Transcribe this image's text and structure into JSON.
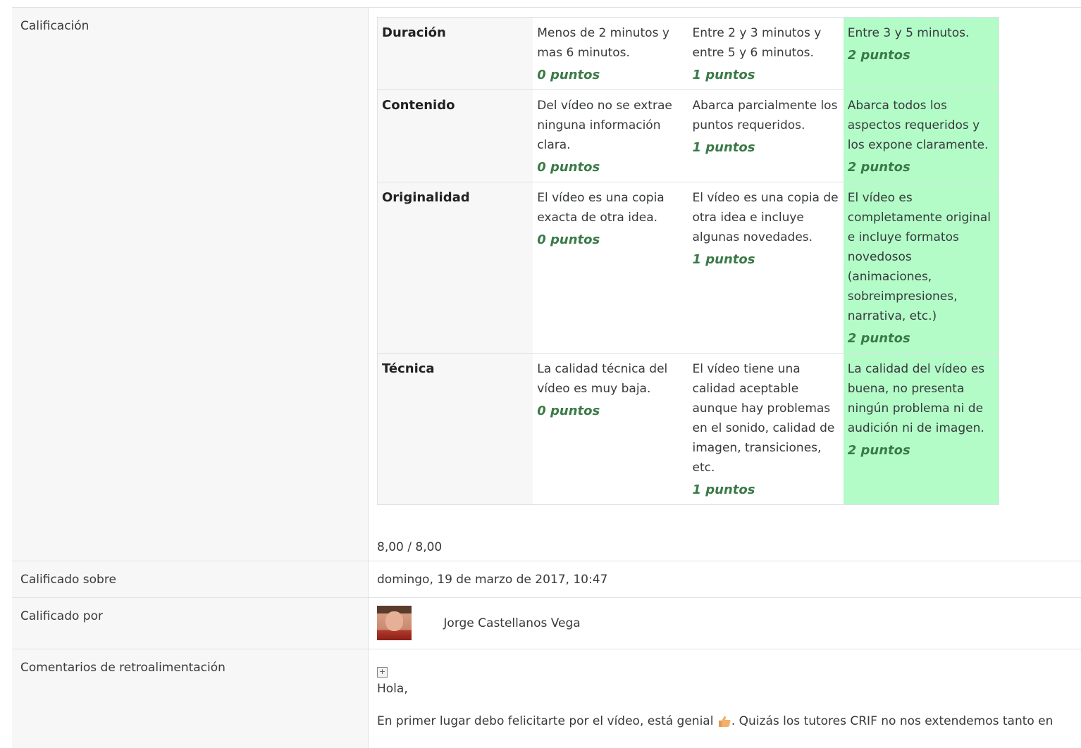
{
  "grade_label": "Calificación",
  "rubric": [
    {
      "criterion": "Duración",
      "levels": [
        {
          "definition": "Menos de 2 minutos y mas 6 minutos.",
          "points": "0 puntos",
          "selected": false
        },
        {
          "definition": "Entre 2 y 3 minutos y entre 5 y 6 minutos.",
          "points": "1 puntos",
          "selected": false
        },
        {
          "definition": "Entre 3 y 5 minutos.",
          "points": "2 puntos",
          "selected": true
        }
      ]
    },
    {
      "criterion": "Contenido",
      "levels": [
        {
          "definition": "Del vídeo no se extrae ninguna información clara.",
          "points": "0 puntos",
          "selected": false
        },
        {
          "definition": "Abarca parcialmente los puntos requeridos.",
          "points": "1 puntos",
          "selected": false
        },
        {
          "definition": "Abarca todos los aspectos requeridos y los expone claramente.",
          "points": "2 puntos",
          "selected": true
        }
      ]
    },
    {
      "criterion": "Originalidad",
      "levels": [
        {
          "definition": "El vídeo es una copia exacta de otra idea.",
          "points": "0 puntos",
          "selected": false
        },
        {
          "definition": "El vídeo es una copia de otra idea e incluye algunas novedades.",
          "points": "1 puntos",
          "selected": false
        },
        {
          "definition": "El vídeo es completamente original e incluye formatos novedosos (animaciones, sobreimpresiones, narrativa, etc.)",
          "points": "2 puntos",
          "selected": true
        }
      ]
    },
    {
      "criterion": "Técnica",
      "levels": [
        {
          "definition": "La calidad técnica del vídeo es muy baja.",
          "points": "0 puntos",
          "selected": false
        },
        {
          "definition": "El vídeo tiene una calidad aceptable aunque hay problemas en el sonido, calidad de imagen, transiciones, etc.",
          "points": "1 puntos",
          "selected": false
        },
        {
          "definition": "La calidad del vídeo es buena, no presenta ningún problema ni de audición ni de imagen.",
          "points": "2 puntos",
          "selected": true
        }
      ]
    }
  ],
  "grade_total": "8,00 / 8,00",
  "graded_on_label": "Calificado sobre",
  "graded_on_value": "domingo, 19 de marzo de 2017, 10:47",
  "graded_by_label": "Calificado por",
  "graded_by_name": "Jorge Castellanos Vega",
  "feedback_label": "Comentarios de retroalimentación",
  "feedback_greeting": "Hola,",
  "feedback_text_before": "En primer lugar debo felicitarte por el vídeo, está genial ",
  "feedback_text_after": ". Quizás los tutores CRIF no nos extendemos tanto en",
  "colors": {
    "selected_level": "#b3fcc8",
    "points": "#3a7a47",
    "label_bg": "#f7f7f7"
  },
  "icons": {
    "expand": "expand-icon",
    "thumb": "thumbs-up-icon"
  }
}
